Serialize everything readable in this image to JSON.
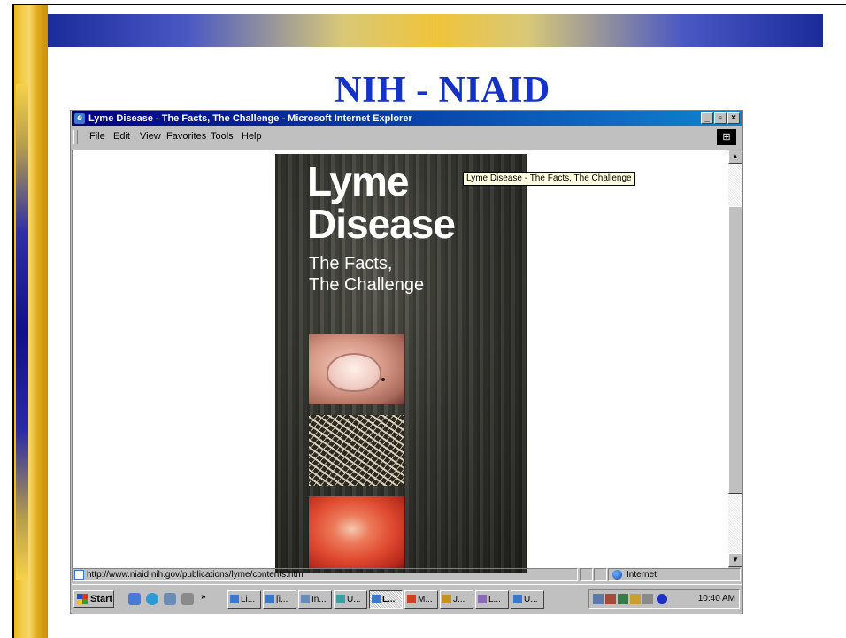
{
  "slide": {
    "title": "NIH - NIAID"
  },
  "window": {
    "title": "Lyme Disease - The Facts, The Challenge - Microsoft Internet Explorer",
    "controls": {
      "minimize": "_",
      "restore": "▫",
      "close": "×"
    }
  },
  "menu": {
    "items": [
      {
        "label": "File"
      },
      {
        "label": "Edit"
      },
      {
        "label": "View"
      },
      {
        "label": "Favorites"
      },
      {
        "label": "Tools"
      },
      {
        "label": "Help"
      }
    ]
  },
  "page": {
    "cover_title_line1": "Lyme",
    "cover_title_line2": "Disease",
    "cover_subtitle_line1": "The Facts,",
    "cover_subtitle_line2": "The Challenge",
    "tooltip": "Lyme Disease - The Facts, The Challenge"
  },
  "status": {
    "url": "http://www.niaid.nih.gov/publications/lyme/contents.htm",
    "zone": "Internet"
  },
  "taskbar": {
    "start_label": "Start",
    "chevron": "»",
    "buttons": [
      {
        "label": "Li..."
      },
      {
        "label": "[i..."
      },
      {
        "label": "In..."
      },
      {
        "label": "U..."
      },
      {
        "label": "L..."
      },
      {
        "label": "M..."
      },
      {
        "label": "J..."
      },
      {
        "label": "L..."
      },
      {
        "label": "U..."
      }
    ],
    "clock": "10:40 AM"
  },
  "colors": {
    "title_blue": "#1432c8",
    "titlebar_start": "#000080",
    "titlebar_end": "#1084d0",
    "chrome_gray": "#c0c0c0"
  },
  "icons": [
    "ie-icon",
    "ie-logo-icon",
    "page-icon",
    "globe-icon",
    "windows-flag-icon",
    "scroll-up-arrow-icon",
    "scroll-down-arrow-icon"
  ]
}
